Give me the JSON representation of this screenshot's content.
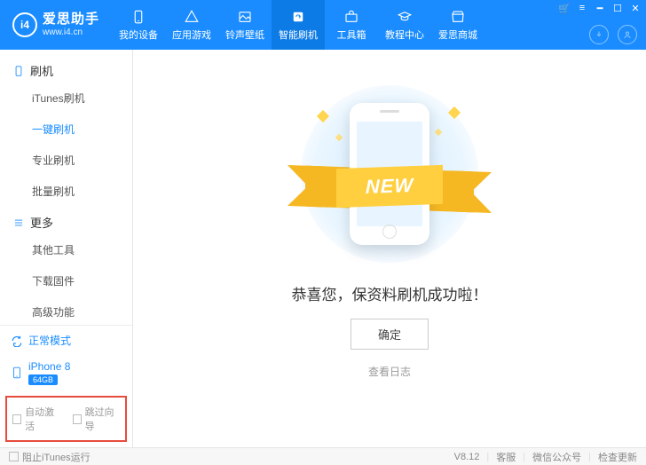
{
  "brand": {
    "logo_text": "i4",
    "name": "爱思助手",
    "url": "www.i4.cn"
  },
  "nav": {
    "items": [
      {
        "label": "我的设备"
      },
      {
        "label": "应用游戏"
      },
      {
        "label": "铃声壁纸"
      },
      {
        "label": "智能刷机"
      },
      {
        "label": "工具箱"
      },
      {
        "label": "教程中心"
      },
      {
        "label": "爱思商城"
      }
    ],
    "active_index": 3
  },
  "sidebar": {
    "section_flash": "刷机",
    "flash_items": [
      "iTunes刷机",
      "一键刷机",
      "专业刷机",
      "批量刷机"
    ],
    "flash_active_index": 1,
    "section_more": "更多",
    "more_items": [
      "其他工具",
      "下载固件",
      "高级功能"
    ],
    "status_label": "正常模式",
    "device_name": "iPhone 8",
    "device_storage": "64GB",
    "opt_auto_activate": "自动激活",
    "opt_skip_guide": "跳过向导"
  },
  "main": {
    "ribbon_text": "NEW",
    "success_msg": "恭喜您，保资料刷机成功啦！",
    "ok_button": "确定",
    "view_log": "查看日志"
  },
  "footer": {
    "block_itunes": "阻止iTunes运行",
    "version": "V8.12",
    "support": "客服",
    "wechat": "微信公众号",
    "update": "检查更新"
  }
}
